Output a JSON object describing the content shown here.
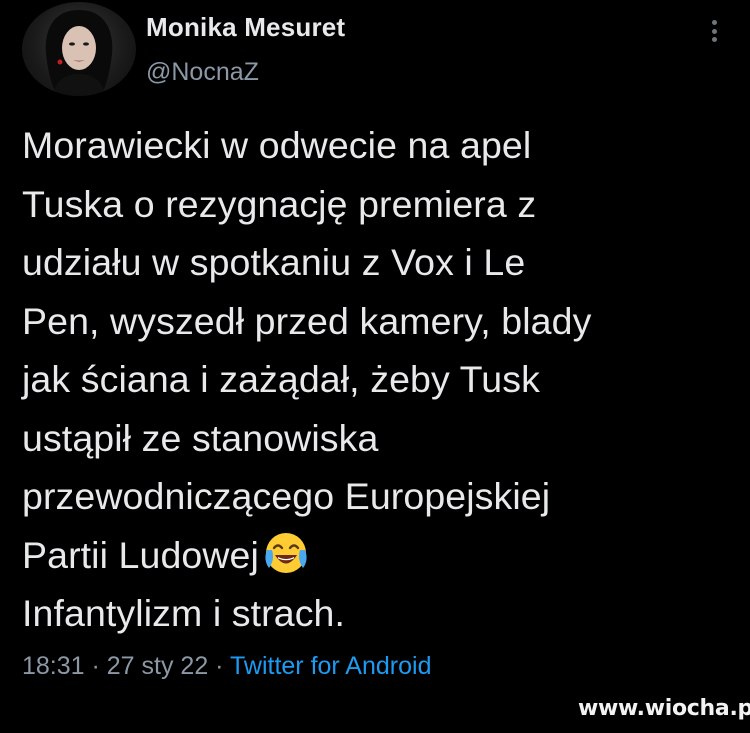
{
  "author": {
    "display_name": "Monika Mesuret",
    "handle": "@NocnaZ",
    "avatar_icon": "profile-photo"
  },
  "more_icon": "vertical-ellipsis-icon",
  "tweet": {
    "lines": [
      "Morawiecki w odwecie na apel",
      "Tuska o rezygnację premiera z",
      "udziału w spotkaniu z Vox i Le",
      "Pen, wyszedł przed kamery, blady",
      "jak ściana i zażądał, żeby Tusk",
      "ustąpił ze stanowiska",
      "przewodniczącego Europejskiej",
      "Partii Ludowej",
      "Infantylizm i strach."
    ],
    "emoji": "face-with-tears-of-joy"
  },
  "meta": {
    "time": "18:31",
    "separator": " · ",
    "date": "27 sty 22",
    "source": "Twitter for Android"
  },
  "watermark": "www.wiocha.pl",
  "colors": {
    "background": "#000000",
    "text": "#e7e9ea",
    "secondary": "#8b98a5",
    "link": "#1d9bf0"
  }
}
